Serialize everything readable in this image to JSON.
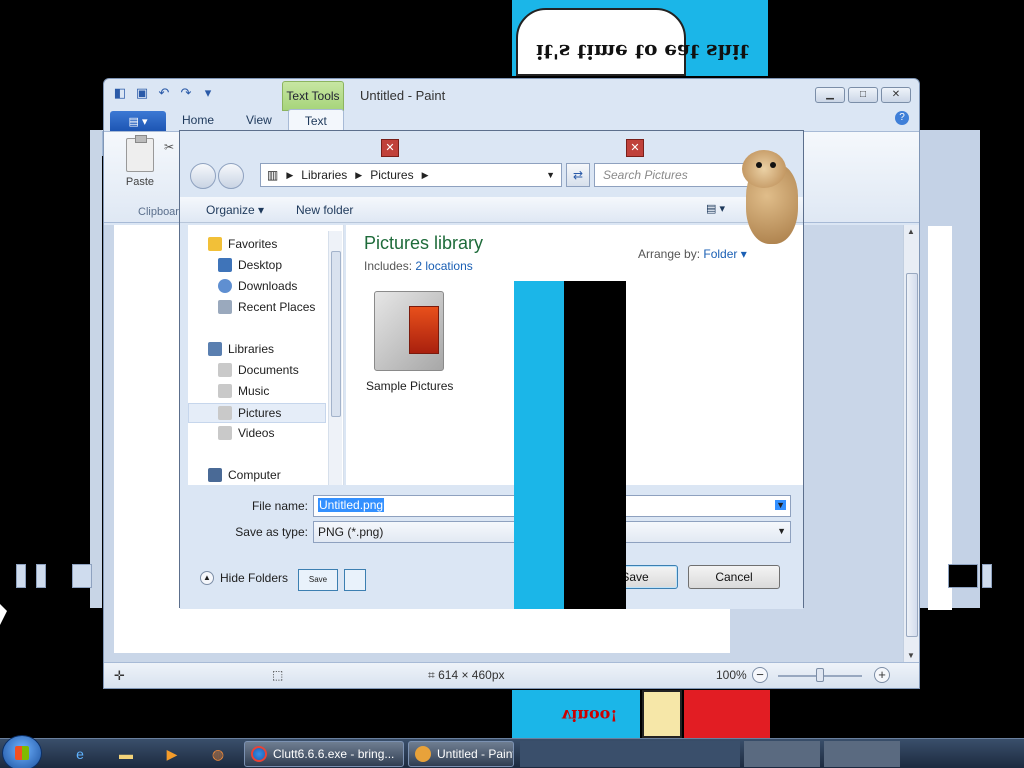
{
  "background": {
    "speech_bubble_text": "it's time to eat shit",
    "bottom_art_text": "vinoo!"
  },
  "paint": {
    "title": "Untitled - Paint",
    "contextual_tab": "Text Tools",
    "tabs": [
      "Home",
      "View",
      "Text"
    ],
    "active_tab": "Text",
    "ribbon": {
      "paste_label": "Paste",
      "clipboard_group": "Clipboard"
    },
    "status": {
      "size": "614 × 460px",
      "zoom": "100%"
    }
  },
  "dialog": {
    "breadcrumb": [
      "Libraries",
      "Pictures"
    ],
    "search_placeholder": "Search Pictures",
    "toolbar": {
      "organize": "Organize",
      "new_folder": "New folder"
    },
    "nav_tree": [
      {
        "label": "Favorites",
        "group": true
      },
      {
        "label": "Desktop"
      },
      {
        "label": "Downloads"
      },
      {
        "label": "Recent Places"
      },
      {
        "label": "Libraries",
        "group": true
      },
      {
        "label": "Documents"
      },
      {
        "label": "Music"
      },
      {
        "label": "Pictures",
        "selected": true
      },
      {
        "label": "Videos"
      },
      {
        "label": "Computer",
        "group": true
      }
    ],
    "content": {
      "title": "Pictures library",
      "includes_label": "Includes:",
      "includes_link": "2 locations",
      "arrange_label": "Arrange by:",
      "arrange_value": "Folder",
      "items": [
        {
          "label": "Sample Pictures"
        }
      ]
    },
    "file_name_label": "File name:",
    "file_name": "Untitled.png",
    "save_type_label": "Save as type:",
    "save_type": "PNG (*.png)",
    "hide_folders": "Hide Folders",
    "mini_save": "Save",
    "save_button": "Save",
    "cancel_button": "Cancel"
  },
  "taskbar": {
    "tasks": [
      {
        "label": "Clutt6.6.6.exe - bring..."
      },
      {
        "label": "Untitled - Paint"
      }
    ]
  }
}
